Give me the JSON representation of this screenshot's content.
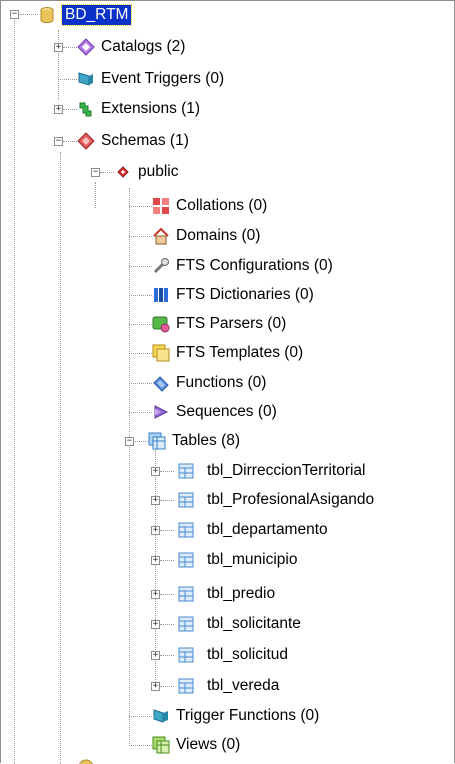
{
  "tree": {
    "root": "BD_RTM",
    "catalogs": "Catalogs (2)",
    "event_triggers": "Event Triggers (0)",
    "extensions": "Extensions (1)",
    "schemas": "Schemas (1)",
    "public": "public",
    "collations": "Collations (0)",
    "domains": "Domains (0)",
    "fts_configurations": "FTS Configurations (0)",
    "fts_dictionaries": "FTS Dictionaries (0)",
    "fts_parsers": "FTS Parsers (0)",
    "fts_templates": "FTS Templates (0)",
    "functions": "Functions (0)",
    "sequences": "Sequences (0)",
    "tables": "Tables (8)",
    "table_items": [
      "tbl_DirreccionTerritorial",
      "tbl_ProfesionalAsigando",
      "tbl_departamento",
      "tbl_municipio",
      "tbl_predio",
      "tbl_solicitante",
      "tbl_solicitud",
      "tbl_vereda"
    ],
    "trigger_functions": "Trigger Functions (0)",
    "views": "Views (0)"
  },
  "icons": {
    "database": "database-icon",
    "catalogs": "catalog-icon",
    "event_triggers": "event-trigger-icon",
    "extensions": "extension-icon",
    "schemas": "schemas-icon",
    "schema": "schema-icon",
    "collation": "collation-icon",
    "domain": "domain-icon",
    "fts_configuration": "fts-configuration-icon",
    "fts_dictionary": "fts-dictionary-icon",
    "fts_parser": "fts-parser-icon",
    "fts_template": "fts-template-icon",
    "function": "function-icon",
    "sequence": "sequence-icon",
    "tables": "tables-icon",
    "table": "table-icon",
    "trigger_function": "trigger-function-icon",
    "view": "view-icon"
  },
  "colors": {
    "selection_bg": "#0a32c8",
    "selection_text": "#ffffff"
  }
}
